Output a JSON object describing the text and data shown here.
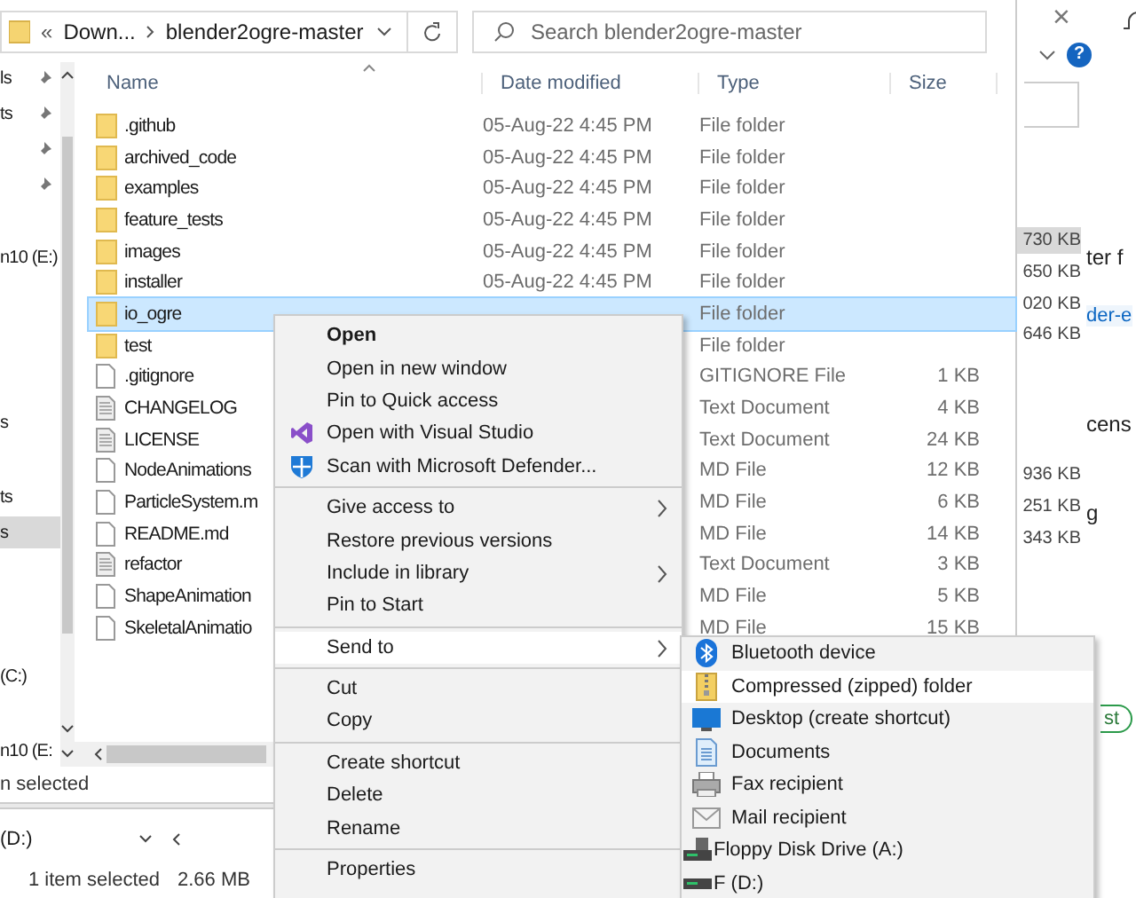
{
  "address": {
    "overflow": "«",
    "parent": "Down...",
    "current": "blender2ogre-master"
  },
  "search": {
    "placeholder": "Search blender2ogre-master"
  },
  "nav": [
    {
      "label": "ls",
      "pinned": true,
      "selected": false
    },
    {
      "label": "ts",
      "pinned": true,
      "selected": false
    },
    {
      "pinned": true,
      "selected": false
    },
    {
      "pinned": true,
      "selected": false
    },
    {
      "label": "n10 (E:)",
      "pinned": false,
      "selected": false
    },
    {
      "label": "s",
      "pinned": false,
      "selected": false
    },
    {
      "label": "ts",
      "pinned": false,
      "selected": false
    },
    {
      "label": "s",
      "pinned": false,
      "selected": true
    },
    {
      "label": "(C:)",
      "pinned": false,
      "selected": false
    },
    {
      "label": "n10 (E:",
      "pinned": false,
      "selected": false
    }
  ],
  "columns": [
    "Name",
    "Date modified",
    "Type",
    "Size"
  ],
  "files": [
    {
      "kind": "folder",
      "name": ".github",
      "date": "05-Aug-22 4:45 PM",
      "type": "File folder",
      "selected": false
    },
    {
      "kind": "folder",
      "name": "archived_code",
      "date": "05-Aug-22 4:45 PM",
      "type": "File folder",
      "selected": false
    },
    {
      "kind": "folder",
      "name": "examples",
      "date": "05-Aug-22 4:45 PM",
      "type": "File folder",
      "selected": false
    },
    {
      "kind": "folder",
      "name": "feature_tests",
      "date": "05-Aug-22 4:45 PM",
      "type": "File folder",
      "selected": false
    },
    {
      "kind": "folder",
      "name": "images",
      "date": "05-Aug-22 4:45 PM",
      "type": "File folder",
      "selected": false
    },
    {
      "kind": "folder",
      "name": "installer",
      "date": "05-Aug-22 4:45 PM",
      "type": "File folder",
      "selected": false
    },
    {
      "kind": "folder",
      "name": "io_ogre",
      "type": "File folder",
      "selected": true
    },
    {
      "kind": "folder",
      "name": "test",
      "type": "File folder",
      "selected": false
    },
    {
      "kind": "file",
      "name": ".gitignore",
      "type": "GITIGNORE File",
      "size": "1 KB",
      "selected": false
    },
    {
      "kind": "text",
      "name": "CHANGELOG",
      "type": "Text Document",
      "size": "4 KB",
      "selected": false
    },
    {
      "kind": "text",
      "name": "LICENSE",
      "type": "Text Document",
      "size": "24 KB",
      "selected": false
    },
    {
      "kind": "file",
      "name": "NodeAnimations",
      "type": "MD File",
      "size": "12 KB",
      "selected": false
    },
    {
      "kind": "file",
      "name": "ParticleSystem.m",
      "type": "MD File",
      "size": "6 KB",
      "selected": false
    },
    {
      "kind": "file",
      "name": "README.md",
      "type": "MD File",
      "size": "14 KB",
      "selected": false
    },
    {
      "kind": "text",
      "name": "refactor",
      "type": "Text Document",
      "size": "3 KB",
      "selected": false
    },
    {
      "kind": "file",
      "name": "ShapeAnimation",
      "type": "MD File",
      "size": "5 KB",
      "selected": false
    },
    {
      "kind": "file",
      "name": "SkeletalAnimatio",
      "type": "MD File",
      "size": "15 KB",
      "selected": false
    }
  ],
  "status": "n selected",
  "lower_window": {
    "drive": "(D:)",
    "status": "1 item selected",
    "size": "2.66 MB"
  },
  "back_window": {
    "sizes": [
      {
        "text": "730 KB",
        "selected": true
      },
      {
        "text": "650 KB",
        "selected": false
      },
      {
        "text": "020 KB",
        "selected": false
      },
      {
        "text": "646 KB",
        "selected": false
      },
      {
        "text": "936 KB",
        "selected": false
      },
      {
        "text": "251 KB",
        "selected": false
      },
      {
        "text": "343 KB",
        "selected": false
      }
    ],
    "texts": [
      {
        "kind": "plain",
        "text": "ter f"
      },
      {
        "kind": "link",
        "text": "der-e"
      },
      {
        "kind": "plain",
        "text": "cens"
      },
      {
        "kind": "plain",
        "text": "g"
      }
    ],
    "close": "×",
    "help": "?",
    "button": "st"
  },
  "menu": [
    {
      "kind": "plain",
      "label": "Open",
      "default": true,
      "submenu": false,
      "highlighted": false
    },
    {
      "kind": "plain",
      "label": "Open in new window",
      "default": false,
      "submenu": false,
      "highlighted": false
    },
    {
      "kind": "plain",
      "label": "Pin to Quick access",
      "default": false,
      "submenu": false,
      "highlighted": false
    },
    {
      "kind": "visual_studio",
      "label": "Open with Visual Studio",
      "default": false,
      "submenu": false,
      "highlighted": false
    },
    {
      "kind": "defender",
      "label": "Scan with Microsoft Defender...",
      "default": false,
      "submenu": false,
      "highlighted": false
    },
    {
      "kind": "separator"
    },
    {
      "kind": "plain",
      "label": "Give access to",
      "default": false,
      "submenu": true,
      "highlighted": false
    },
    {
      "kind": "plain",
      "label": "Restore previous versions",
      "default": false,
      "submenu": false,
      "highlighted": false
    },
    {
      "kind": "plain",
      "label": "Include in library",
      "default": false,
      "submenu": true,
      "highlighted": false
    },
    {
      "kind": "plain",
      "label": "Pin to Start",
      "default": false,
      "submenu": false,
      "highlighted": false
    },
    {
      "kind": "separator"
    },
    {
      "kind": "plain",
      "label": "Send to",
      "default": false,
      "submenu": true,
      "highlighted": true
    },
    {
      "kind": "separator"
    },
    {
      "kind": "plain",
      "label": "Cut",
      "default": false,
      "submenu": false,
      "highlighted": false
    },
    {
      "kind": "plain",
      "label": "Copy",
      "default": false,
      "submenu": false,
      "highlighted": false
    },
    {
      "kind": "separator"
    },
    {
      "kind": "plain",
      "label": "Create shortcut",
      "default": false,
      "submenu": false,
      "highlighted": false
    },
    {
      "kind": "plain",
      "label": "Delete",
      "default": false,
      "submenu": false,
      "highlighted": false
    },
    {
      "kind": "plain",
      "label": "Rename",
      "default": false,
      "submenu": false,
      "highlighted": false
    },
    {
      "kind": "separator"
    },
    {
      "kind": "plain",
      "label": "Properties",
      "default": false,
      "submenu": false,
      "highlighted": false
    }
  ],
  "send_to": [
    {
      "kind": "bluetooth",
      "label": "Bluetooth device",
      "highlighted": false
    },
    {
      "kind": "zip",
      "label": "Compressed (zipped) folder",
      "highlighted": true
    },
    {
      "kind": "desktop",
      "label": "Desktop (create shortcut)",
      "highlighted": false
    },
    {
      "kind": "documents",
      "label": "Documents",
      "highlighted": false
    },
    {
      "kind": "fax",
      "label": "Fax recipient",
      "highlighted": false
    },
    {
      "kind": "mail",
      "label": "Mail recipient",
      "highlighted": false
    },
    {
      "kind": "floppy",
      "label": "Floppy Disk Drive (A:)",
      "highlighted": false
    },
    {
      "kind": "drive",
      "label": "F (D:)",
      "highlighted": false
    }
  ]
}
